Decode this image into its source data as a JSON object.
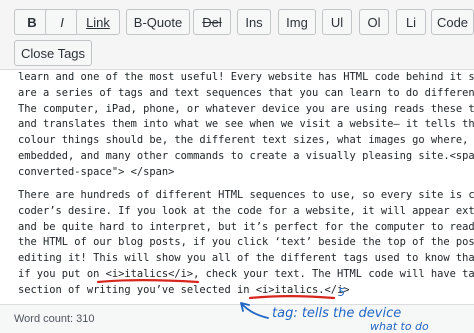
{
  "toolbar": {
    "buttons": [
      "B",
      "I",
      "Link",
      "B-Quote",
      "Del",
      "Ins",
      "Img",
      "Ul",
      "Ol",
      "Li",
      "Code"
    ],
    "close_tags": "Close Tags"
  },
  "editor": {
    "paragraph1": [
      "learn and one of the most useful! Every website has HTML code behind it s",
      "are a series of tags and text sequences that you can learn to do different",
      "The computer, iPad, phone, or whatever device you are using reads these tag",
      "and translates them into what we see when we visit a website— it tells the",
      "colour things should be, the different text sizes, what images go where, if",
      "embedded, and many other commands to create a visually pleasing site.<span",
      "converted-space\"> </span>"
    ],
    "paragraph2": [
      "There are hundreds of different HTML sequences to use, so every site is cus",
      "coder’s desire. If you look at the code for a website, it will appear extre",
      "and be quite hard to interpret, but it’s perfect for the computer to read.",
      "the HTML of our blog posts, if you click ‘text’ beside the top of the post",
      "editing it! This will show you all of the different tags used to know that",
      "if you put on <i>italics</i>, check your text. The HTML code will have tags",
      "section of writing you’ve selected in <i>italics.</i>"
    ]
  },
  "status": {
    "word_count": "Word count: 310"
  },
  "annotation": {
    "number": "5",
    "text_line1": "tag: tells the device",
    "text_line2": "what to do"
  },
  "colors": {
    "annotation_red": "#d7261e",
    "annotation_blue": "#2166c4"
  }
}
